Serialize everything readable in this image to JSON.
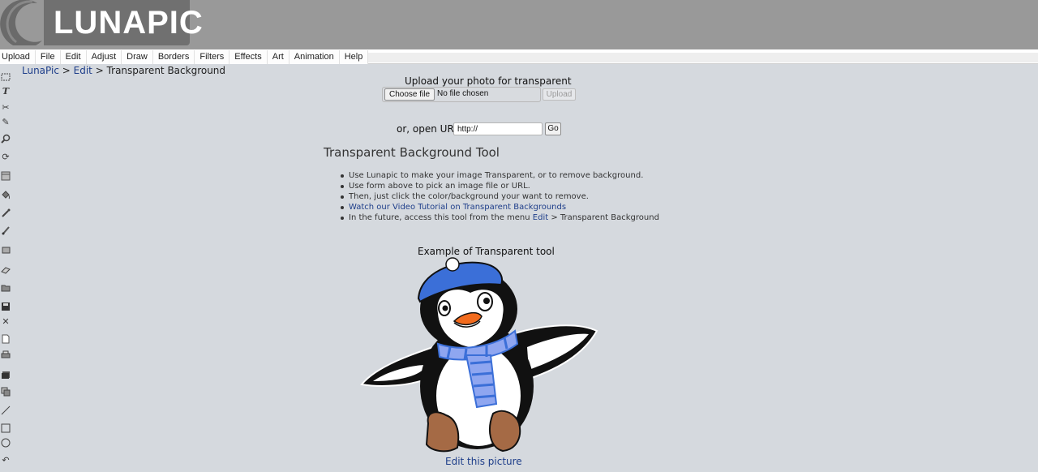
{
  "header": {
    "logo_text": "LUNAPIC"
  },
  "menu": [
    "Upload",
    "File",
    "Edit",
    "Adjust",
    "Draw",
    "Borders",
    "Filters",
    "Effects",
    "Art",
    "Animation",
    "Help"
  ],
  "breadcrumb": {
    "home": "LunaPic",
    "sep1": " > ",
    "section": "Edit",
    "sep2": " > ",
    "current": "Transparent Background"
  },
  "toolbar": [
    "select-icon",
    "text-icon",
    "scissors-icon",
    "pencil-icon",
    "zoom-icon",
    "rotate-icon",
    "layers-icon",
    "paint-bucket-icon",
    "eyedropper-icon",
    "brush-icon",
    "crop-icon",
    "eraser-icon",
    "open-folder-icon",
    "save-icon",
    "close-icon",
    "new-document-icon",
    "print-icon",
    "stack-icon",
    "copy-icon",
    "line-icon",
    "rectangle-icon",
    "circle-icon",
    "undo-icon"
  ],
  "upload": {
    "title": "Upload your photo for transparent",
    "choose_label": "Choose file",
    "no_file": "No file chosen",
    "upload_label": "Upload",
    "url_label": "or, open URL",
    "url_value": "http://",
    "go_label": "Go"
  },
  "tool": {
    "title": "Transparent Background Tool",
    "bullet1": "Use Lunapic to make your image Transparent, or to remove background.",
    "bullet2": "Use form above to pick an image file or URL.",
    "bullet3": "Then, just click the color/background your want to remove.",
    "bullet4_link": "Watch our Video Tutorial on Transparent Backgrounds",
    "bullet5_prefix": "In the future, access this tool from the menu ",
    "bullet5_link": "Edit",
    "bullet5_suffix": " > Transparent Background"
  },
  "example": {
    "title": "Example of Transparent tool",
    "edit_link": "Edit this picture"
  },
  "colors": {
    "background": "#d5d9de",
    "header": "#999999",
    "link": "#1e3e8a",
    "hat": "#3b6fd8"
  }
}
